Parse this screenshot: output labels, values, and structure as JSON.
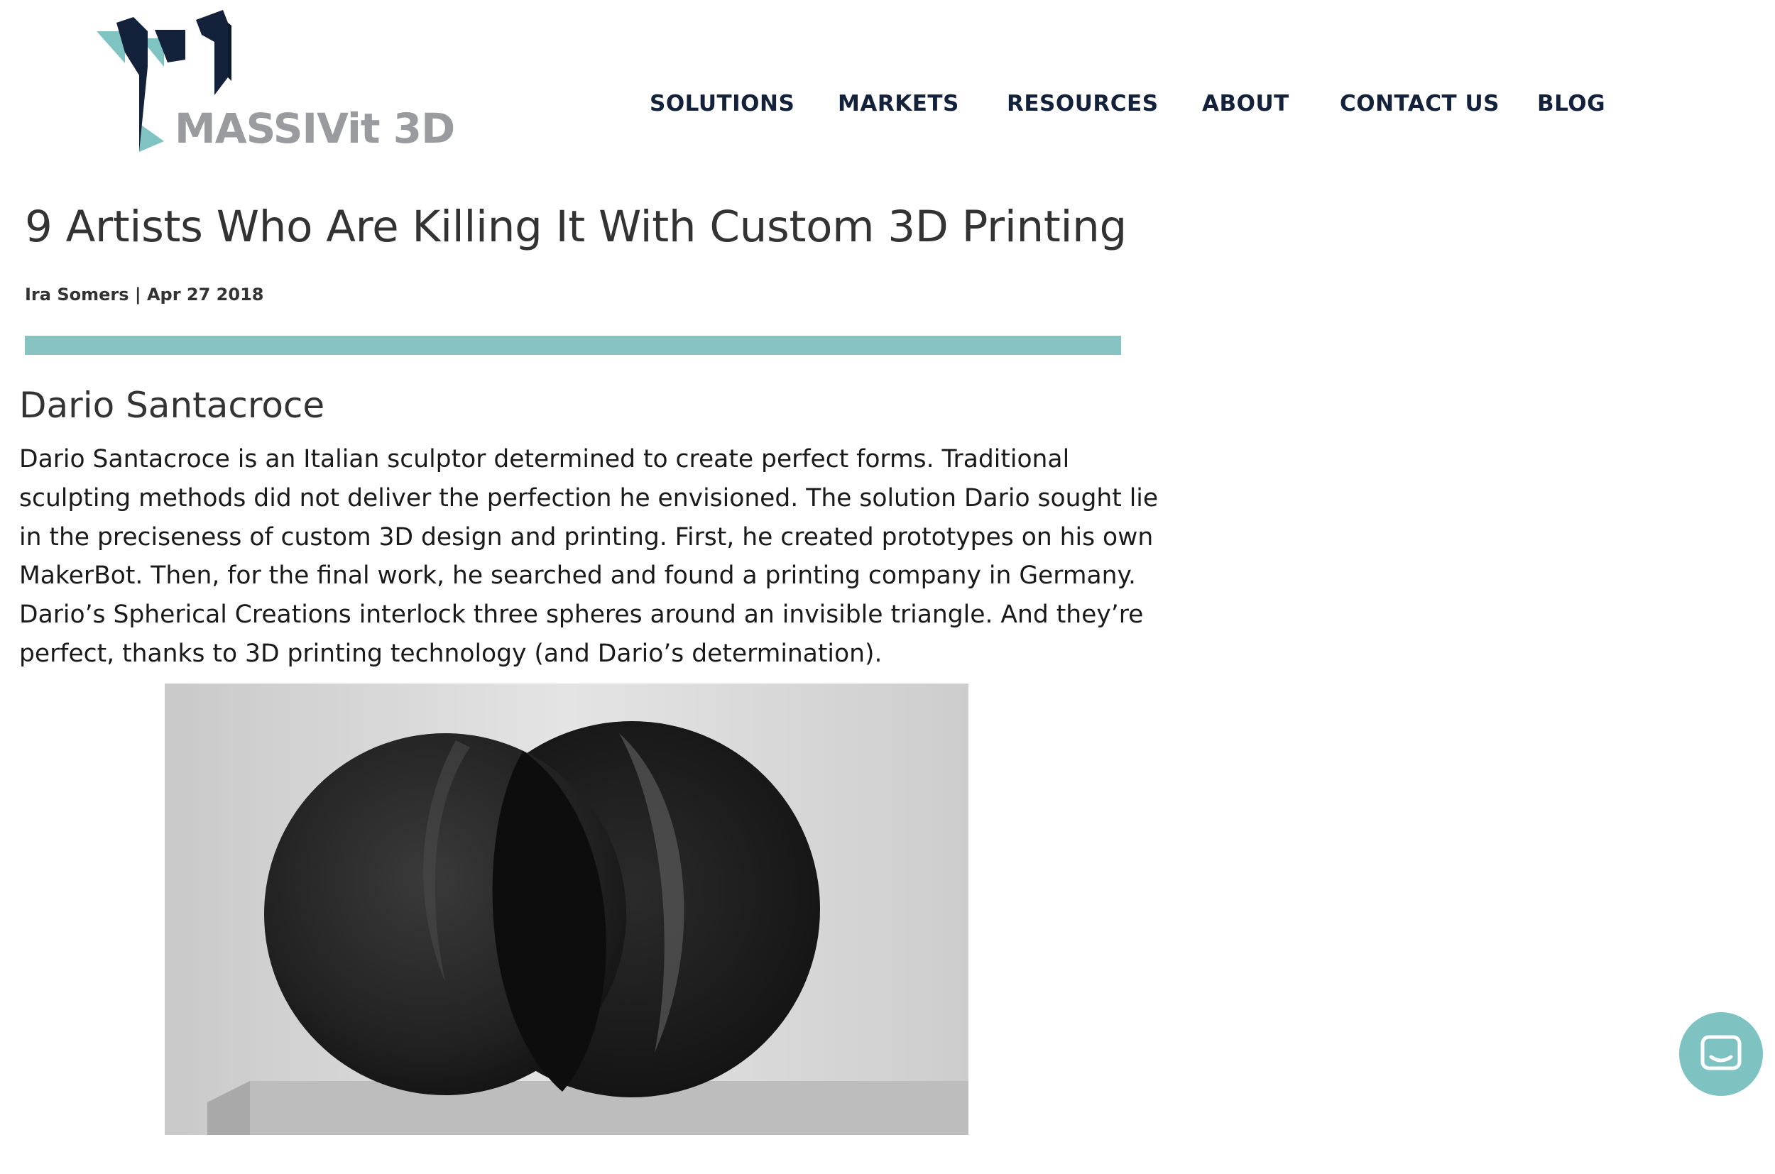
{
  "brand": {
    "logo_text": "MASSIVit 3D"
  },
  "nav": {
    "items": [
      "SOLUTIONS",
      "MARKETS",
      "RESOURCES",
      "ABOUT",
      "CONTACT US",
      "BLOG"
    ]
  },
  "article": {
    "title": "9 Artists Who Are Killing It With Custom 3D Printing",
    "byline": "Ira Somers | Apr 27 2018",
    "section_heading": "Dario Santacroce",
    "paragraph_lines": [
      "Dario Santacroce is an Italian sculptor determined to create perfect forms. Traditional",
      "sculpting methods did not deliver the perfection he envisioned. The solution Dario sought lie",
      "in the preciseness of custom 3D design and printing. First, he created prototypes on his own",
      "MakerBot. Then, for the final work, he searched and found a printing company in Germany.",
      "Dario’s Spherical Creations interlock three spheres around an invisible triangle. And they’re",
      "perfect, thanks to 3D printing technology (and Dario’s determination)."
    ]
  },
  "icons": {
    "chat": "chat-bubble-icon"
  },
  "colors": {
    "accent": "#86c3c1",
    "nav_text": "#13213a",
    "logo_dark": "#13213a",
    "logo_teal": "#7fc4c2",
    "logo_gray": "#999b9e",
    "chat_button": "#7ec3c1"
  }
}
